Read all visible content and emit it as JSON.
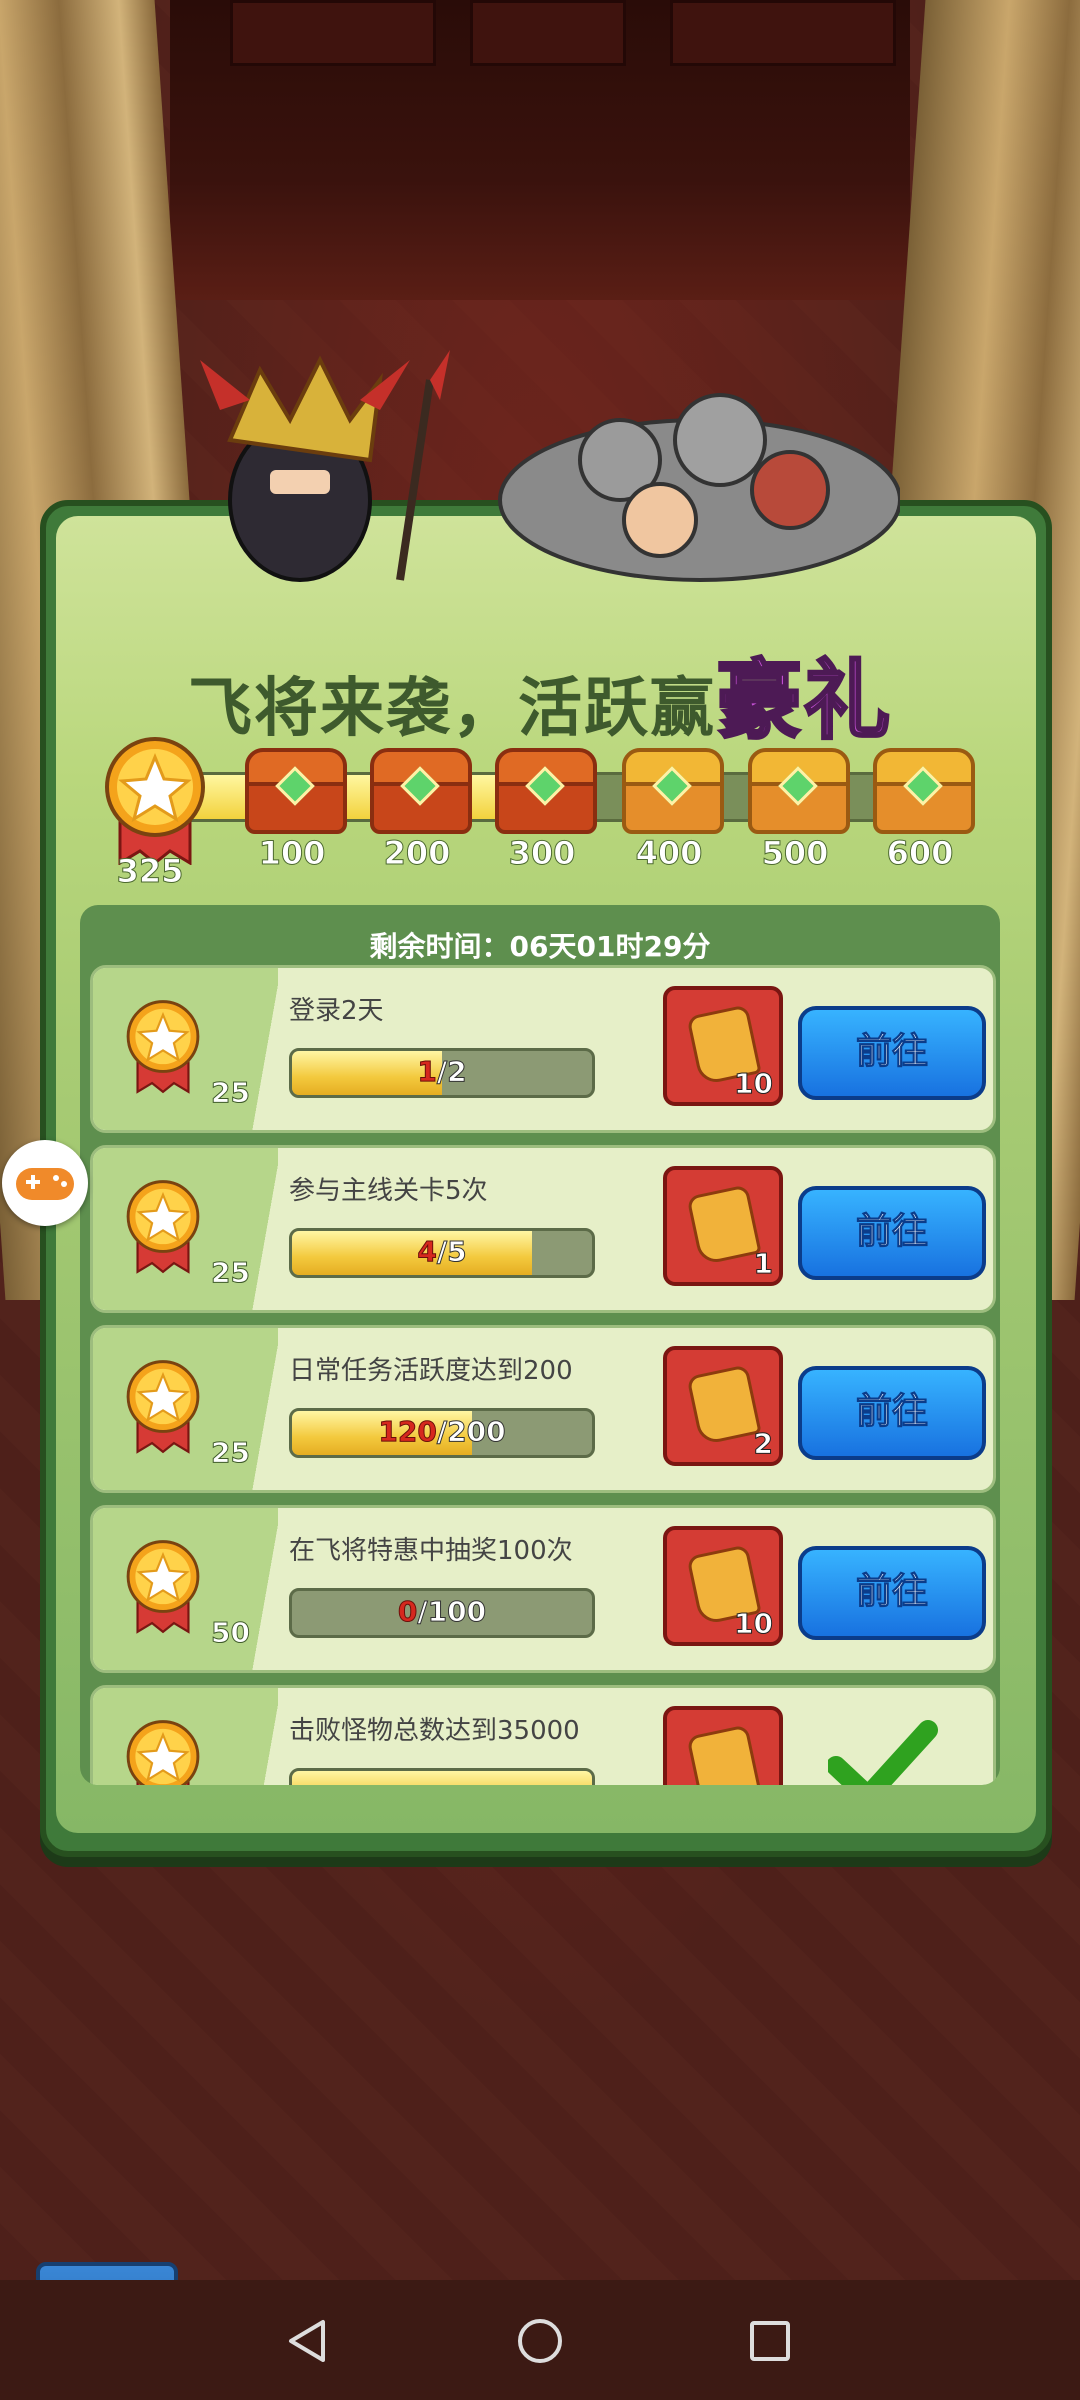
{
  "event": {
    "title_main": "飞将来袭，活跃赢",
    "title_highlight": "豪礼",
    "current_points": "325",
    "progress_fraction": 0.54,
    "milestones": [
      "100",
      "200",
      "300",
      "400",
      "500",
      "600"
    ],
    "milestone_claimed": [
      true,
      true,
      true,
      false,
      false,
      false
    ]
  },
  "timer": {
    "label": "剩余时间：06天01时29分"
  },
  "tasks": [
    {
      "points": "25",
      "name": "登录2天",
      "current": "1",
      "total": "/2",
      "progress": 0.5,
      "reward_qty": "10",
      "action": "前往"
    },
    {
      "points": "25",
      "name": "参与主线关卡5次",
      "current": "4",
      "total": "/5",
      "progress": 0.8,
      "reward_qty": "1",
      "action": "前往"
    },
    {
      "points": "25",
      "name": "日常任务活跃度达到200",
      "current": "120",
      "total": "/200",
      "progress": 0.6,
      "reward_qty": "2",
      "action": "前往"
    },
    {
      "points": "50",
      "name": "在飞将特惠中抽奖100次",
      "current": "0",
      "total": "/100",
      "progress": 0.0,
      "reward_qty": "10",
      "action": "前往"
    },
    {
      "points": "",
      "name": "击败怪物总数达到35000",
      "current": "",
      "total": "",
      "progress": 1.0,
      "reward_qty": "",
      "action": "completed"
    }
  ],
  "icons": {
    "back": "back-arrow-icon",
    "gamepad": "gamepad-icon",
    "nav_back": "triangle-back-icon",
    "nav_home": "circle-home-icon",
    "nav_recent": "square-recents-icon"
  },
  "colors": {
    "panel": "#3f7a3a",
    "button": "#1872e0",
    "reward_bg": "#d43c34",
    "title_highlight": "#c24fd2"
  }
}
